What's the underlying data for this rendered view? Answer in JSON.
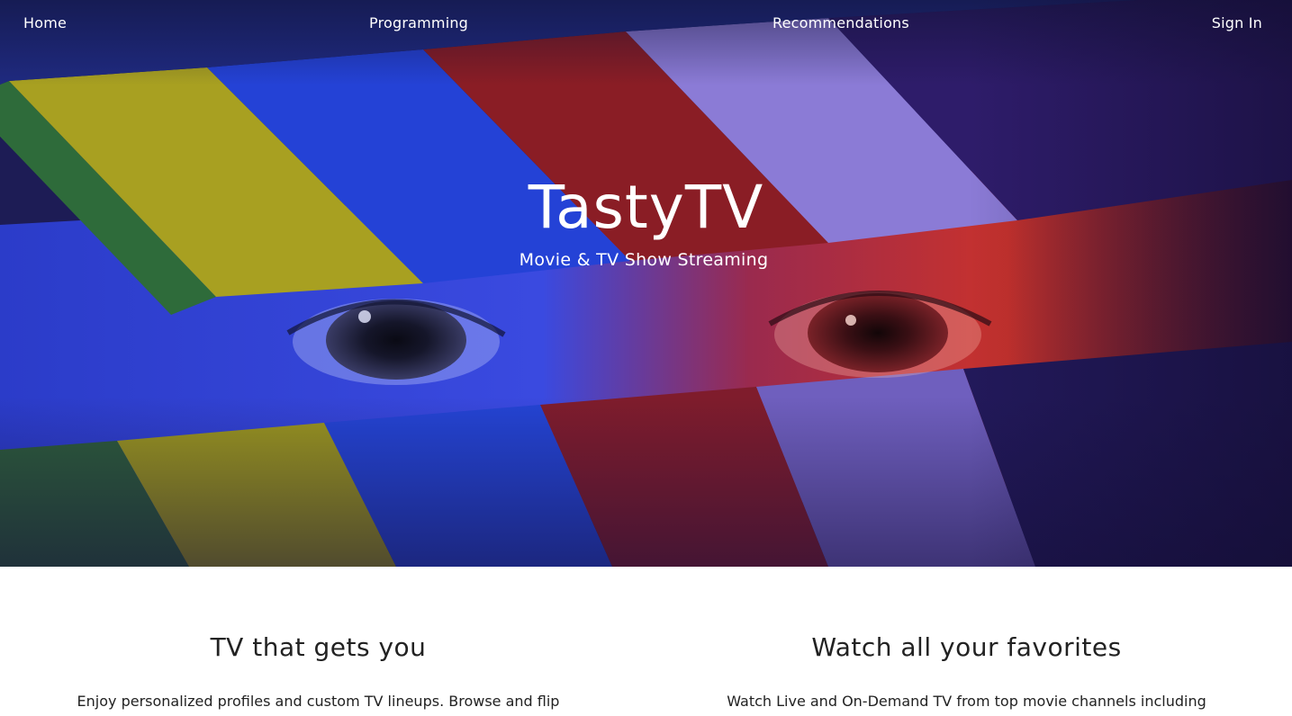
{
  "nav": {
    "home": "Home",
    "programming": "Programming",
    "recommendations": "Recommendations",
    "sign_in": "Sign In"
  },
  "hero": {
    "title": "TastyTV",
    "subtitle": "Movie & TV Show Streaming",
    "background_image": "clapperboard-eyes-photo"
  },
  "features": [
    {
      "heading": "TV that gets you",
      "text": "Enjoy personalized profiles and custom TV lineups. Browse and flip"
    },
    {
      "heading": "Watch all your favorites",
      "text": "Watch Live and On-Demand TV from top movie channels including"
    }
  ],
  "colors": {
    "hero_blue": "#2a3bd6",
    "hero_red": "#c8302a",
    "hero_dark": "#1b1a4a",
    "text_white": "#ffffff",
    "text_dark": "#222222",
    "page_bg": "#ffffff"
  }
}
